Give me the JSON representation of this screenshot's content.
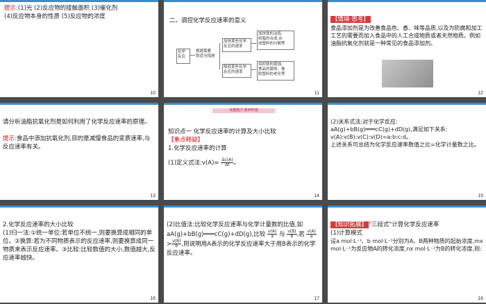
{
  "slides": [
    {
      "number": "10",
      "line1_label": "提示:",
      "line1_text": "(1)光 (2)反应物的接触面积 (3)催化剂",
      "line2": "(4)反应物本身的性质 (5)反应物的浓度"
    },
    {
      "number": "11",
      "title": "二、调控化学反应速率的意义",
      "d_left": "化学\n反应",
      "d_mid": "根据需要\n取适当措施",
      "d_top": "加快某些化学\n反应的速率",
      "d_bot": "降低某些化学\n反应的速率",
      "d_top_right": "加快铁的冶炼,\n树脂的合成,合\n成塑料的分解等",
      "d_bot_right": "如抑铁的腐蚀、\n食品的腐败、橡\n胶塑料的老化等"
    },
    {
      "number": "12",
      "header": "【情境·思考】",
      "text": "食品添加剂是为改善食品色、香、味等品质,以及为防腐和加工工艺的需要而加入食品中的人工合成物质或者天然物质。例如油脂抗氧化剂就是一种常见的食品添加剂。",
      "image_label": "food-photo"
    },
    {
      "number": "13",
      "question": "请分析油脂抗氧化剂是如何利用了化学反应速率的原理。",
      "hint_label": "提示:",
      "hint": "食品中添加抗氧化剂,目的是减慢食品的变质速率,与反应速率有关。"
    },
    {
      "number": "14",
      "band": "关键能力·素养形成",
      "point": "知识点一 化学反应速率的计算及大小比较",
      "tag": "【重点释疑】",
      "sub": "1.化学反应速率的计算",
      "formula_label": "(1)定义式法:v(A)=",
      "frac_num": "Δc(A)",
      "frac_den": "Δt"
    },
    {
      "number": "15",
      "l1": "(2)关系式法:对于化学反应:",
      "l2": "aA(g)+bB(g)═══cC(g)+dD(g),满足如下关系:",
      "l3": "v(A):v(B):v(C):v(D)=a:b:c:d。",
      "l4": "上述关系可总结为化学反应速率数值之比=化学计量数之比。"
    },
    {
      "number": "16",
      "title": "2.化学反应速率的大小比较",
      "text": "(1)归一法:①统一单位:若单位不统一,则要换算成相同的单位。②换算:若为不同物质表示的反应速率,则要换算成同一物质来表示反应速率。③比较:比较数值的大小,数值越大,反应速率越快。"
    },
    {
      "number": "17",
      "text1": "(2)比值法:比较化学反应速率与化学计量数的比值,如aA(g)+bB(g)═══cC(g)+dD(g),比较",
      "f1n": "v(A)",
      "f1d": "a",
      "mid": "与",
      "f2n": "v(B)",
      "f2d": "b",
      "text2": ",若",
      "f3n": "v(A)",
      "f3d": "a",
      "gt": ">",
      "f4n": "v(B)",
      "f4d": "b",
      "text3": ",则说明用A表示的化学反应速率大于用B表示的化学反应速率。"
    },
    {
      "number": "18",
      "tag": "【知识拓展】",
      "head": "\"三段式\"计算化学反应速率",
      "sub": "(1)计算模式",
      "text": "设a mol·L⁻¹、b mol·L⁻¹分别为A、B两种物质的起始浓度,mx mol·L⁻¹为反应物A的转化浓度,nx mol·L⁻¹为B的转化浓度,则:"
    }
  ],
  "colors": {
    "background": "#4a4a4a",
    "accent_red": "#c81818",
    "topbar": "#3a8dc9"
  }
}
